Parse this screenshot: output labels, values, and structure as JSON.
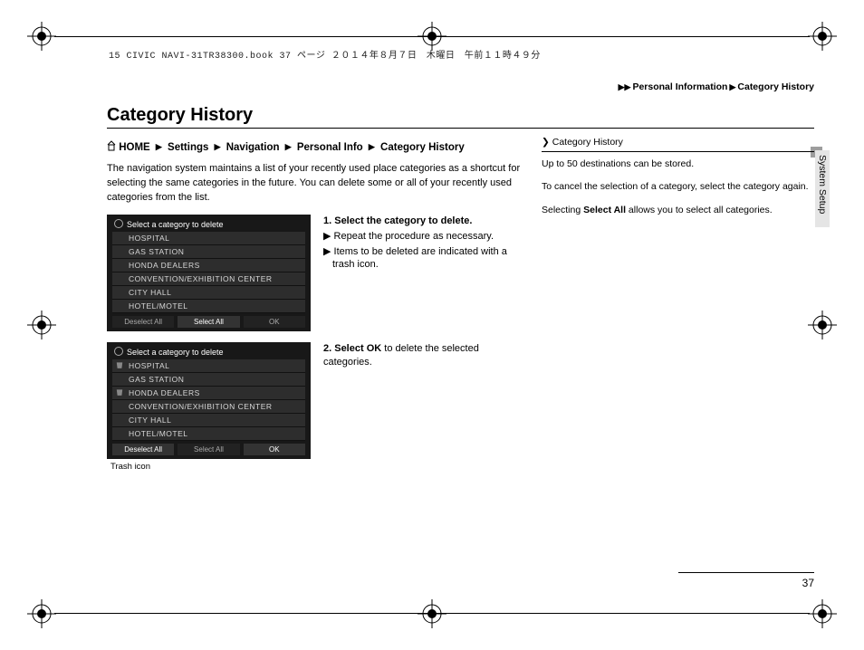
{
  "meta_header": "15 CIVIC NAVI-31TR38300.book  37 ページ  ２０１４年８月７日　木曜日　午前１１時４９分",
  "top_crumb": {
    "a": "Personal Information",
    "b": "Category History"
  },
  "title": "Category History",
  "breadcrumb": [
    "HOME",
    "Settings",
    "Navigation",
    "Personal Info",
    "Category History"
  ],
  "intro": "The navigation system maintains a list of your recently used place categories as a shortcut for selecting the same categories in the future. You can delete some or all of your recently used categories from the list.",
  "shot1": {
    "title": "Select a category to delete",
    "items": [
      "HOSPITAL",
      "GAS STATION",
      "HONDA DEALERS",
      "CONVENTION/EXHIBITION CENTER",
      "CITY HALL",
      "HOTEL/MOTEL"
    ],
    "foot": [
      "Deselect All",
      "Select All",
      "OK"
    ]
  },
  "shot2": {
    "title": "Select a category to delete",
    "items": [
      "HOSPITAL",
      "GAS STATION",
      "HONDA DEALERS",
      "CONVENTION/EXHIBITION CENTER",
      "CITY HALL",
      "HOTEL/MOTEL"
    ],
    "foot": [
      "Deselect All",
      "Select All",
      "OK"
    ],
    "caption": "Trash icon"
  },
  "step1": {
    "lead": "1. Select the category to delete.",
    "b1": "Repeat the procedure as necessary.",
    "b2": "Items to be deleted are indicated with a trash icon."
  },
  "step2": {
    "lead_a": "2. Select ",
    "lead_ok": "OK",
    "lead_b": " to delete the selected categories."
  },
  "aside": {
    "heading": "Category History",
    "p1": "Up to 50 destinations can be stored.",
    "p2": "To cancel the selection of a category, select the category again.",
    "p3a": "Selecting ",
    "p3b": "Select All",
    "p3c": " allows you to select all categories."
  },
  "side_tab": "System Setup",
  "page_number": "37"
}
